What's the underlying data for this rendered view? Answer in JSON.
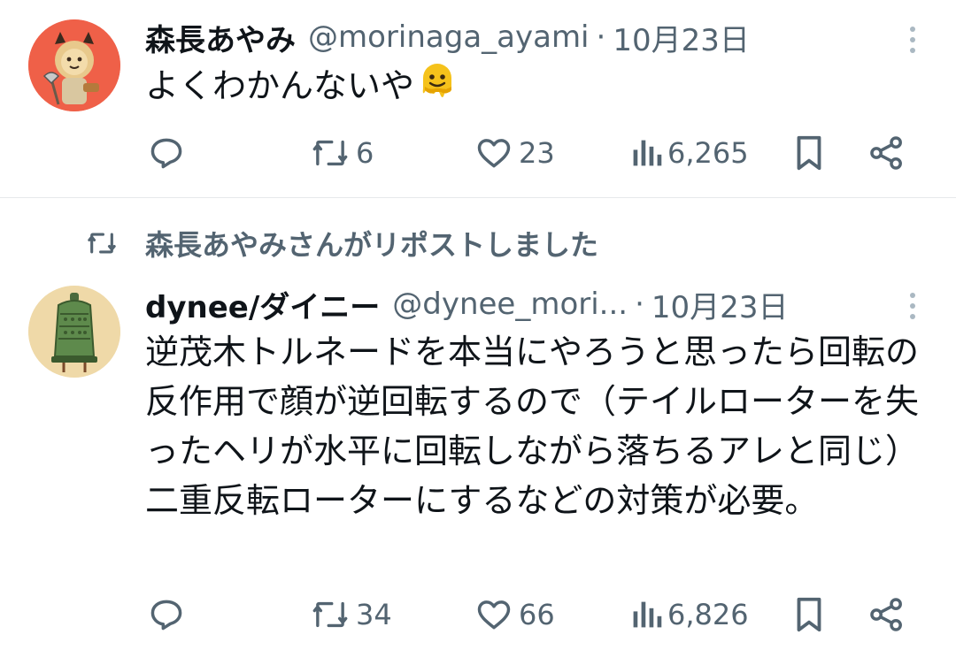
{
  "tweets": [
    {
      "name": "森長あやみ",
      "handle": "@morinaga_ayami",
      "date": "10月23日",
      "text": "よくわかんないや",
      "emoji": "melting-face-emoji",
      "replies": "",
      "retweets": "6",
      "likes": "23",
      "views": "6,265"
    },
    {
      "repost_label": "森長あやみさんがリポストしました",
      "name": "dynee/ダイニー",
      "handle": "@dynee_mori...",
      "date": "10月23日",
      "text": "逆茂木トルネードを本当にやろうと思ったら回転の反作用で顔が逆回転するので（テイルローターを失ったヘリが水平に回転しながら落ちるアレと同じ）二重反転ローターにするなどの対策が必要。",
      "replies": "",
      "retweets": "34",
      "likes": "66",
      "views": "6,826"
    }
  ],
  "separator": "·",
  "colors": {
    "text": "#0f1419",
    "secondary": "#536471",
    "divider": "#e6e9eb",
    "avatar1_bg": "#ef6048",
    "avatar2_bg": "#efd9a8"
  },
  "icons": [
    "reply-icon",
    "retweet-icon",
    "like-icon",
    "views-icon",
    "bookmark-icon",
    "share-icon",
    "more-icon"
  ]
}
